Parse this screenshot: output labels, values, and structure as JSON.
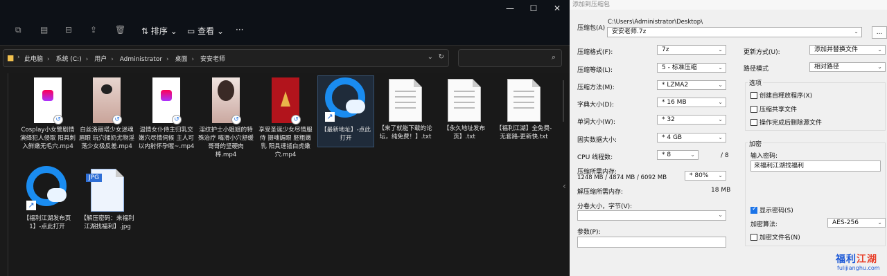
{
  "explorer": {
    "window_controls": [
      "—",
      "☐",
      "✕"
    ],
    "toolbar": {
      "sort": "排序",
      "view": "查看",
      "more": "···"
    },
    "breadcrumb": [
      "此电脑",
      "系统 (C:)",
      "用户",
      "Administrator",
      "桌面",
      "安安老师"
    ],
    "files": [
      {
        "name": "Cosplay小女警剧情演绎犯人侵取 阳具刺入鲜嫩无毛穴.mp4",
        "kind": "video-logo"
      },
      {
        "name": "白丝洛丽塔少女迷魂眉眼 玩穴揉奶尤物淫荡少女极反差.mp4",
        "kind": "video-girl"
      },
      {
        "name": "温情女仆侍主归乳交嫩穴尽情伺候 主人可以内射怀孕喔~.mp4",
        "kind": "video-logo"
      },
      {
        "name": "淫纹护士小姐姐的特殊治疗 嘴滑小穴舒缓哥哥的坚硬肉棒.mp4",
        "kind": "video-girl"
      },
      {
        "name": "享受圣诞少女尽情服侍 摄魂媚眼 胚粗嫩乳 阳具速插白虎嫩穴.mp4",
        "kind": "video-red"
      },
      {
        "name": "【最新地址】-点此打开",
        "kind": "shortcut"
      },
      {
        "name": "【来了就能下载的论坛，纯免费！】.txt",
        "kind": "txt"
      },
      {
        "name": "【永久地址发布页】.txt",
        "kind": "txt"
      },
      {
        "name": "【福利江湖】全免费-无套路-更新快.txt",
        "kind": "txt"
      },
      {
        "name": "【福利江湖发布页1】-点此打开",
        "kind": "shortcut"
      },
      {
        "name": "【解压密码：来福利江湖找福利】.jpg",
        "kind": "jpg"
      }
    ],
    "jpg_label": "JPG"
  },
  "dialog": {
    "title": "添加到压缩包",
    "archive_label": "压缩包(A)",
    "archive_path": "C:\\Users\\Administrator\\Desktop\\",
    "archive_name": "安安老师.7z",
    "browse": "...",
    "format_label": "压缩格式(F):",
    "format": "7z",
    "level_label": "压缩等级(L):",
    "level": "5 - 标准压缩",
    "method_label": "压缩方法(M):",
    "method": "* LZMA2",
    "dict_label": "字典大小(D):",
    "dict": "* 16 MB",
    "word_label": "单词大小(W):",
    "word": "* 32",
    "solid_label": "固实数据大小:",
    "solid": "* 4 GB",
    "cpu_label": "CPU 线程数:",
    "cpu": "* 8",
    "cpu_total": "/ 8",
    "mem_label": "压缩所需内存:",
    "mem_values": "1248 MB / 4874 MB / 6092 MB",
    "mem_pct": "* 80%",
    "decomp_label": "解压缩所需内存:",
    "decomp": "18 MB",
    "split_label": "分卷大小，字节(V):",
    "params_label": "参数(P):",
    "update_label": "更新方式(U):",
    "update": "添加并替换文件",
    "path_label": "路径模式",
    "path": "相对路径",
    "options_title": "选项",
    "opt_sfx": "创建自释放程序(X)",
    "opt_shared": "压缩共享文件",
    "opt_delete": "操作完成后删除源文件",
    "enc_title": "加密",
    "pwd_label": "输入密码:",
    "pwd": "来福利江湖找福利",
    "show_pwd": "显示密码(S)",
    "enc_method_label": "加密算法:",
    "enc_method": "AES-256",
    "enc_names": "加密文件名(N)"
  },
  "watermark": {
    "title_a": "福利",
    "title_b": "江湖",
    "url": "fulijianghu.com"
  }
}
